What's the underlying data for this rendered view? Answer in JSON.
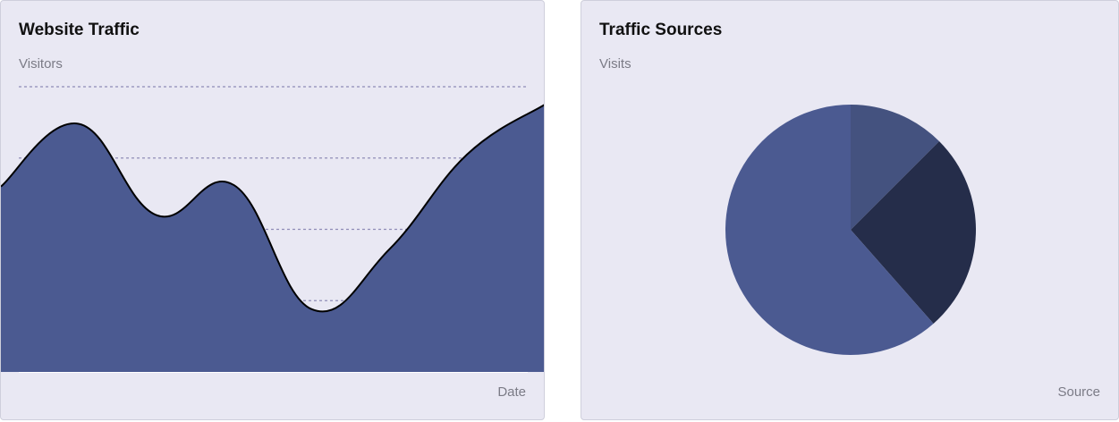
{
  "charts": {
    "traffic": {
      "title": "Website Traffic",
      "ylabel": "Visitors",
      "xlabel": "Date"
    },
    "sources": {
      "title": "Traffic Sources",
      "ylabel": "Visits",
      "xlabel": "Source"
    }
  },
  "colors": {
    "area_fill": "#4b5a91",
    "line": "#000000",
    "grid": "#8f8cb6",
    "pie": [
      "#44527f",
      "#252d4a",
      "#4b5a91"
    ]
  },
  "chart_data": [
    {
      "type": "area",
      "title": "Website Traffic",
      "ylabel": "Visitors",
      "xlabel": "Date",
      "x": [
        0,
        1,
        2,
        3,
        4,
        5,
        6,
        7
      ],
      "values": [
        260,
        348,
        220,
        262,
        88,
        172,
        305,
        375
      ],
      "ylim": [
        0,
        400
      ],
      "grid": true
    },
    {
      "type": "pie",
      "title": "Traffic Sources",
      "ylabel": "Visits",
      "xlabel": "Source",
      "values": [
        12.5,
        26,
        61.5
      ],
      "legend": "none"
    }
  ]
}
